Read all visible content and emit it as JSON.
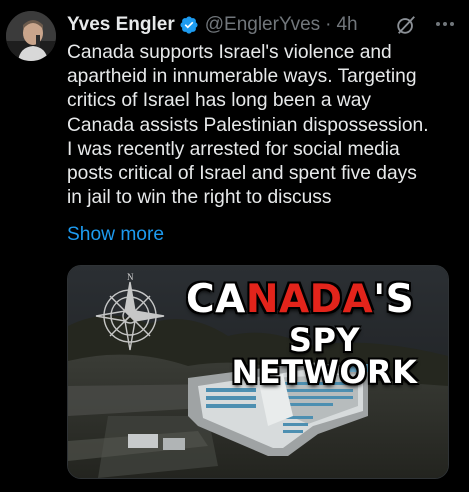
{
  "tweet": {
    "author": {
      "display_name": "Yves Engler",
      "handle": "@EnglerYves",
      "verified": true
    },
    "separator": "·",
    "time": "4h",
    "text_lines": [
      "Canada supports Israel's violence and",
      "apartheid in innumerable ways. Targeting",
      "critics of Israel has long been a way",
      "Canada assists Palestinian dispossession.",
      "I was recently arrested for social media",
      "posts critical of Israel and spent five days",
      "in jail to win the right to discuss"
    ],
    "show_more_label": "Show more",
    "media": {
      "headline_line1_parts": [
        "CA",
        "NADA",
        "'S"
      ],
      "headline_line2": "SPY NETWORK",
      "compass_label": "N"
    },
    "icons": {
      "verified": "verified-badge-icon",
      "grok": "grok-icon",
      "more": "more-options-icon"
    },
    "colors": {
      "background": "#000000",
      "text_primary": "#e7e9ea",
      "text_secondary": "#71767b",
      "link": "#1d9bf0",
      "verified": "#1d9bf0",
      "headline_red": "#e3241b"
    }
  }
}
